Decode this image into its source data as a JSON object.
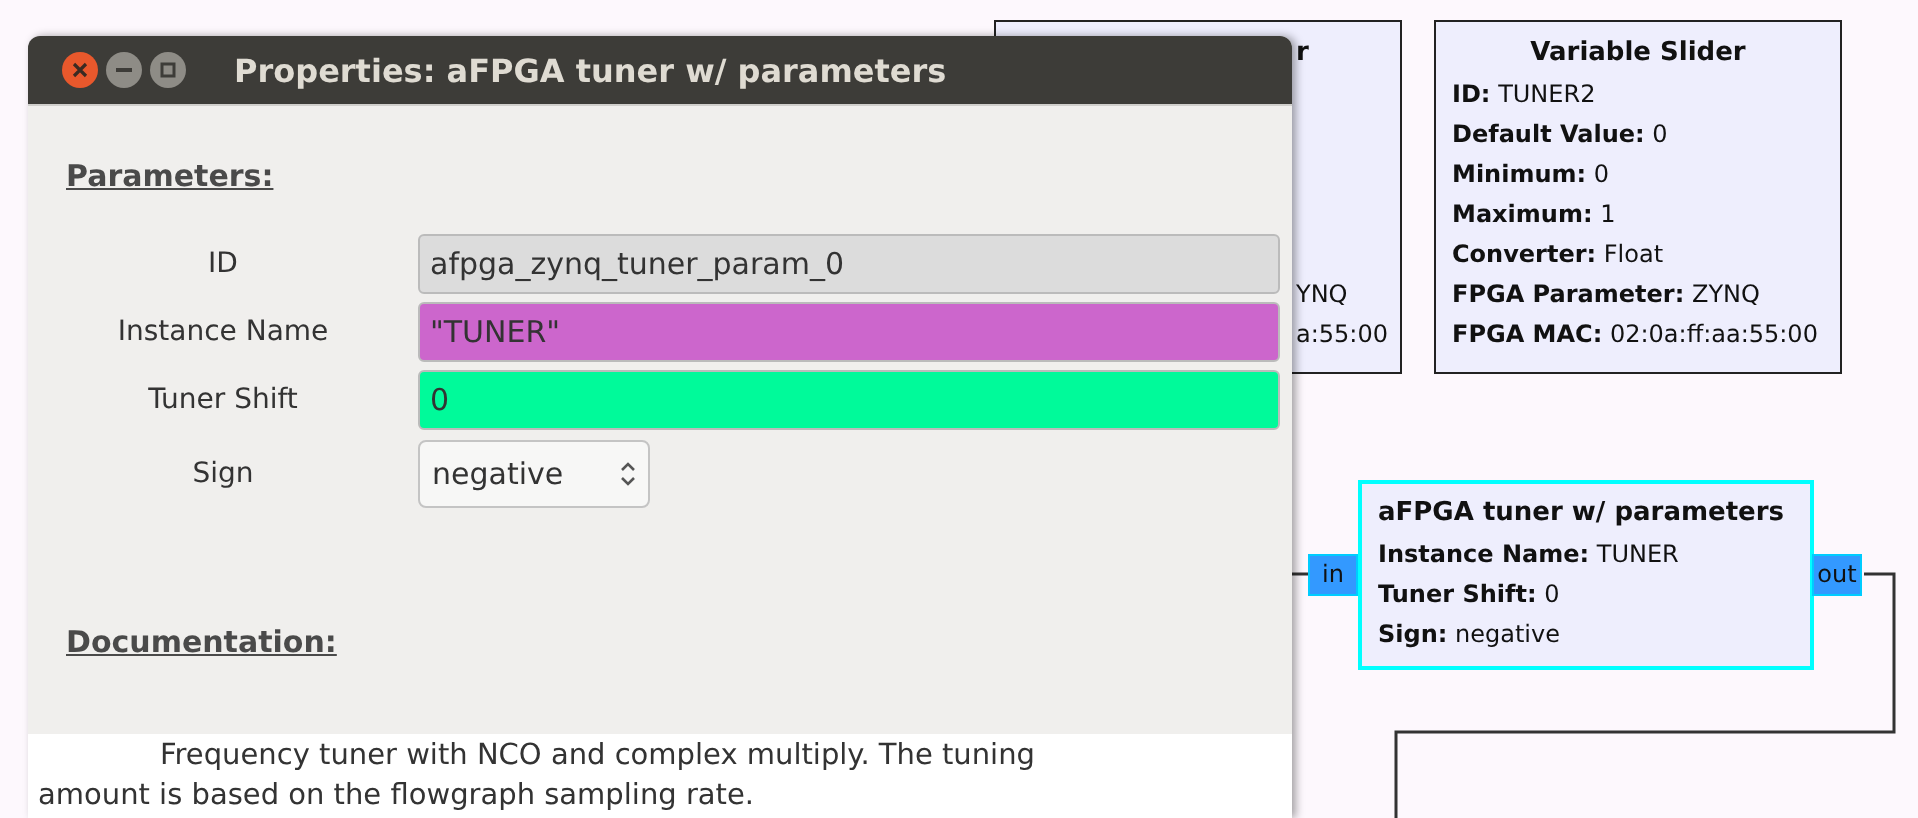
{
  "dialog": {
    "title": "Properties: aFPGA tuner w/ parameters",
    "parameters_heading": "Parameters:",
    "params": [
      {
        "label": "ID",
        "value": "afpga_zynq_tuner_param_0",
        "kind": "text",
        "color": "#dcdcdc"
      },
      {
        "label": "Instance Name",
        "value": "\"TUNER\"",
        "kind": "text",
        "color": "#cc66cc"
      },
      {
        "label": "Tuner Shift",
        "value": "0",
        "kind": "text",
        "color": "#00fa9a"
      },
      {
        "label": "Sign",
        "value": "negative",
        "kind": "select"
      }
    ],
    "documentation_heading": "Documentation:",
    "documentation": "Frequency tuner with NCO and complex multiply. The tuning amount is based on the flowgraph sampling rate."
  },
  "hidden_block": {
    "fragments": [
      "r",
      "YNQ",
      "a:55:00"
    ]
  },
  "variable_slider": {
    "title": "Variable Slider",
    "selected": false,
    "props": [
      {
        "key": "ID:",
        "value": "TUNER2"
      },
      {
        "key": "Default Value:",
        "value": "0"
      },
      {
        "key": "Minimum:",
        "value": "0"
      },
      {
        "key": "Maximum:",
        "value": "1"
      },
      {
        "key": "Converter:",
        "value": "Float"
      },
      {
        "key": "FPGA Parameter:",
        "value": "ZYNQ"
      },
      {
        "key": "FPGA MAC:",
        "value": "02:0a:ff:aa:55:00"
      }
    ]
  },
  "tuner_block": {
    "title": "aFPGA tuner w/ parameters",
    "selected": true,
    "props": [
      {
        "key": "Instance Name:",
        "value": "TUNER"
      },
      {
        "key": "Tuner Shift:",
        "value": "0"
      },
      {
        "key": "Sign:",
        "value": "negative"
      }
    ],
    "ports": [
      {
        "label": "in"
      },
      {
        "label": "out"
      }
    ]
  }
}
